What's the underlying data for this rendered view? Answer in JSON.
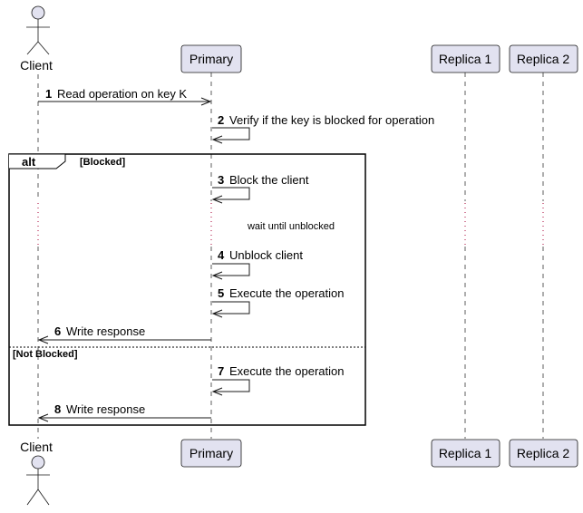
{
  "participants": {
    "client": "Client",
    "primary": "Primary",
    "replica1": "Replica 1",
    "replica2": "Replica 2"
  },
  "messages": [
    {
      "num": "1",
      "text": "Read operation on key K"
    },
    {
      "num": "2",
      "text": "Verify if the key is blocked for operation"
    },
    {
      "num": "3",
      "text": "Block the client"
    },
    {
      "num": "4",
      "text": "Unblock client"
    },
    {
      "num": "5",
      "text": "Execute the operation"
    },
    {
      "num": "6",
      "text": "Write response"
    },
    {
      "num": "7",
      "text": "Execute the operation"
    },
    {
      "num": "8",
      "text": "Write response"
    }
  ],
  "alt": {
    "keyword": "alt",
    "guard1": "[Blocked]",
    "guard2": "[Not Blocked]"
  },
  "delay_note": "wait until unblocked",
  "colors": {
    "participant_fill": "#E2E2F0",
    "participant_border": "#181818",
    "lifeline": "#181818",
    "delay_dots": "#A80036"
  }
}
